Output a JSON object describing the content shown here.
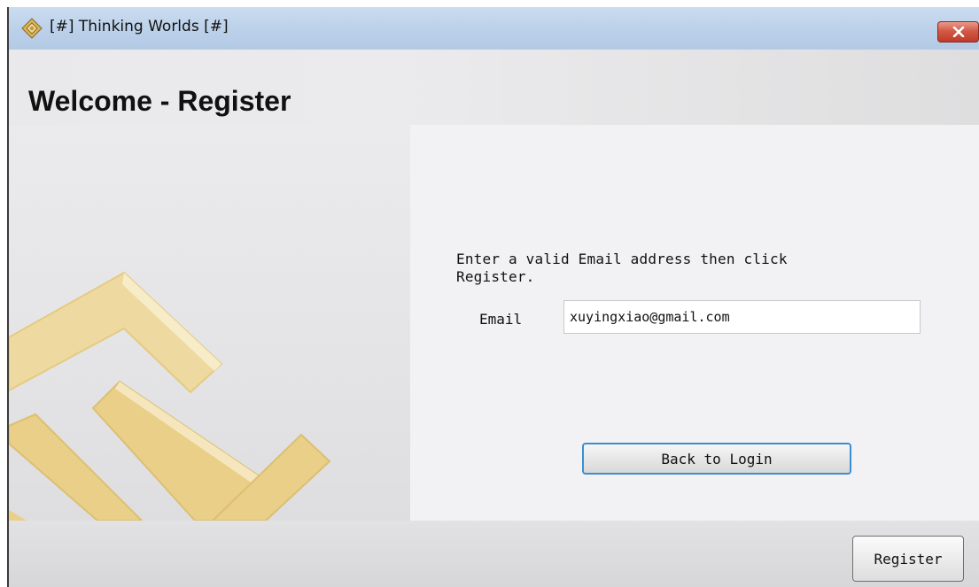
{
  "window": {
    "title": "[#] Thinking Worlds [#]",
    "icon": "thinking-worlds-diamond-icon",
    "close_icon": "close-icon"
  },
  "header": {
    "title": "Welcome - Register"
  },
  "form": {
    "instructions": "Enter a valid Email address then click Register.",
    "email_label": "Email",
    "email_value": "xuyingxiao@gmail.com",
    "back_button_label": "Back to Login"
  },
  "footer": {
    "register_button_label": "Register"
  },
  "colors": {
    "titlebar": "#bcd1ea",
    "close_button": "#c0392b",
    "logo_gold": "#e8cf8a",
    "focus_border": "#3c8ed0"
  }
}
